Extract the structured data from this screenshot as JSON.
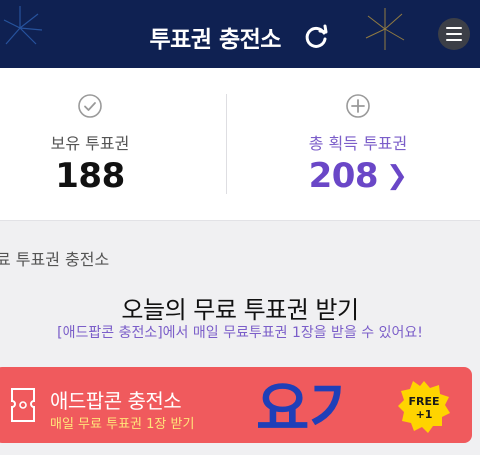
{
  "header": {
    "title": "투표권 충전소",
    "refresh_icon": "refresh-icon",
    "menu_icon": "menu-icon"
  },
  "stats": {
    "owned": {
      "label": "보유 투표권",
      "value": "188",
      "icon": "check-circle-icon"
    },
    "total": {
      "label": "총 획득 투표권",
      "value": "208",
      "icon": "plus-circle-icon"
    }
  },
  "section": {
    "label": "료 투표권 충전소"
  },
  "promo": {
    "title": "오늘의 무료 투표권 받기",
    "subtitle": "[애드팝콘 충전소]에서 매일 무료투표권 1장을 받을 수 있어요!"
  },
  "banner": {
    "title": "애드팝콘 충전소",
    "subtitle": "매일 무료 투표권 1장 받기",
    "brush_text": "요기",
    "badge_line1": "FREE",
    "badge_line2": "+1"
  },
  "colors": {
    "header_bg": "#0f2152",
    "accent_purple": "#6a47c7",
    "banner_bg": "#f05a5d",
    "badge_yellow": "#ffd400"
  }
}
